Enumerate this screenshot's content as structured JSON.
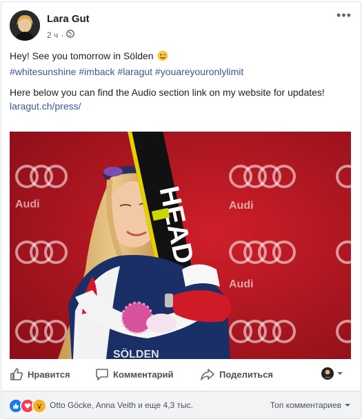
{
  "post": {
    "author": "Lara Gut",
    "time": "2 ч",
    "line1": "Hey! See you tomorrow in Sölden",
    "hashtags": "#whitesunshine #imback #laragut #youareyouronlylimit",
    "line2": "Here below you can find the Audio section link on my website for updates!",
    "url": "laragut.ch/press/"
  },
  "photo": {
    "brand_text": "Audi",
    "ski_text": "HEAD",
    "bottom_text": "SÖLDEN"
  },
  "actions": {
    "like": "Нравится",
    "comment": "Комментарий",
    "share": "Поделиться"
  },
  "footer": {
    "reactions_text": "Otto Göcke, Anna Veith и еще 4,3 тыс.",
    "sort_label": "Топ комментариев"
  },
  "colors": {
    "link": "#385898",
    "like_blue": "#1877f2",
    "love_red": "#f33e58",
    "wow_yellow": "#f7b125",
    "audi_red": "#b5121b"
  },
  "icons": [
    "globe-icon",
    "more-icon",
    "wink-emoji-icon",
    "like-icon",
    "comment-icon",
    "share-icon",
    "chevron-down-icon"
  ]
}
